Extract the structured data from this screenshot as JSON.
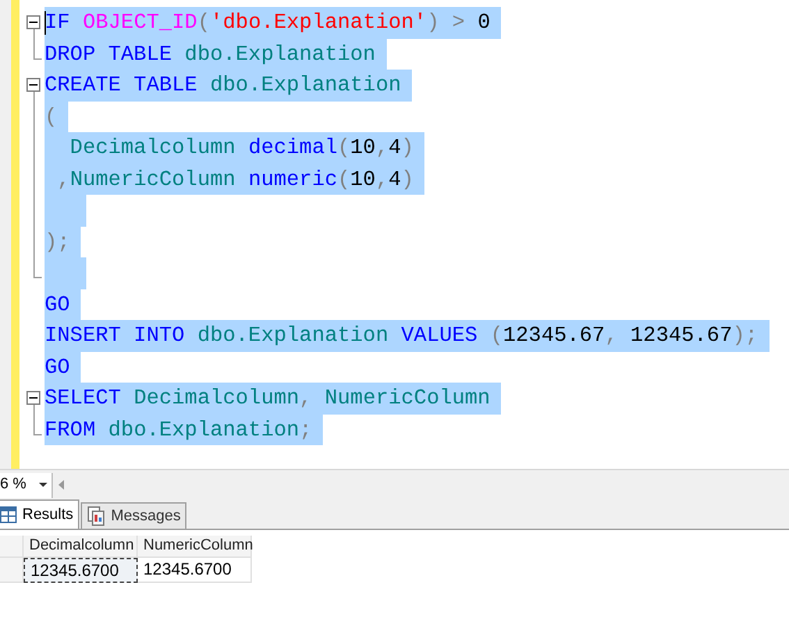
{
  "editor": {
    "lines": [
      {
        "kind": "fold-start",
        "selected": true,
        "caret": true,
        "tokens": [
          {
            "kind": "keyword",
            "text": "IF "
          },
          {
            "kind": "function",
            "text": "OBJECT_ID"
          },
          {
            "kind": "punct",
            "text": "("
          },
          {
            "kind": "string",
            "text": "'dbo.Explanation'"
          },
          {
            "kind": "punct",
            "text": ") > "
          },
          {
            "kind": "number",
            "text": "0"
          }
        ]
      },
      {
        "kind": "fold-end",
        "selected": true,
        "caret": false,
        "tokens": [
          {
            "kind": "keyword",
            "text": "DROP TABLE "
          },
          {
            "kind": "identifier",
            "text": "dbo.Explanation"
          }
        ]
      },
      {
        "kind": "fold-start",
        "selected": true,
        "caret": false,
        "tokens": [
          {
            "kind": "keyword",
            "text": "CREATE TABLE "
          },
          {
            "kind": "identifier",
            "text": "dbo.Explanation"
          }
        ]
      },
      {
        "kind": "fold-inner",
        "selected": true,
        "caret": false,
        "tokens": [
          {
            "kind": "punct",
            "text": "("
          }
        ]
      },
      {
        "kind": "fold-inner",
        "selected": true,
        "caret": false,
        "tokens": [
          {
            "kind": "identifier",
            "text": "  Decimalcolumn "
          },
          {
            "kind": "keyword",
            "text": "decimal"
          },
          {
            "kind": "punct",
            "text": "("
          },
          {
            "kind": "number",
            "text": "10"
          },
          {
            "kind": "punct",
            "text": ","
          },
          {
            "kind": "number",
            "text": "4"
          },
          {
            "kind": "punct",
            "text": ")"
          }
        ]
      },
      {
        "kind": "fold-inner",
        "selected": true,
        "caret": false,
        "tokens": [
          {
            "kind": "punct",
            "text": " ,"
          },
          {
            "kind": "identifier",
            "text": "NumericColumn "
          },
          {
            "kind": "keyword",
            "text": "numeric"
          },
          {
            "kind": "punct",
            "text": "("
          },
          {
            "kind": "number",
            "text": "10"
          },
          {
            "kind": "punct",
            "text": ","
          },
          {
            "kind": "number",
            "text": "4"
          },
          {
            "kind": "punct",
            "text": ")"
          }
        ]
      },
      {
        "kind": "fold-inner",
        "selected": true,
        "caret": false
      },
      {
        "kind": "fold-inner",
        "selected": true,
        "caret": false,
        "tokens": [
          {
            "kind": "punct",
            "text": ");"
          }
        ]
      },
      {
        "kind": "fold-end",
        "selected": true,
        "caret": false
      },
      {
        "kind": "plain",
        "selected": true,
        "caret": false,
        "tokens": [
          {
            "kind": "keyword",
            "text": "GO"
          }
        ]
      },
      {
        "kind": "plain",
        "selected": true,
        "caret": false,
        "tokens": [
          {
            "kind": "keyword",
            "text": "INSERT INTO "
          },
          {
            "kind": "identifier",
            "text": "dbo.Explanation "
          },
          {
            "kind": "keyword",
            "text": "VALUES "
          },
          {
            "kind": "punct",
            "text": "("
          },
          {
            "kind": "number",
            "text": "12345.67"
          },
          {
            "kind": "punct",
            "text": ", "
          },
          {
            "kind": "number",
            "text": "12345.67"
          },
          {
            "kind": "punct",
            "text": ");"
          }
        ]
      },
      {
        "kind": "plain",
        "selected": true,
        "caret": false,
        "tokens": [
          {
            "kind": "keyword",
            "text": "GO"
          }
        ]
      },
      {
        "kind": "fold-start",
        "selected": true,
        "caret": false,
        "tokens": [
          {
            "kind": "keyword",
            "text": "SELECT "
          },
          {
            "kind": "identifier",
            "text": "Decimalcolumn"
          },
          {
            "kind": "punct",
            "text": ", "
          },
          {
            "kind": "identifier",
            "text": "NumericColumn"
          }
        ]
      },
      {
        "kind": "fold-end",
        "selected": true,
        "caret": false,
        "tokens": [
          {
            "kind": "keyword",
            "text": "FROM "
          },
          {
            "kind": "identifier",
            "text": "dbo.Explanation"
          },
          {
            "kind": "punct",
            "text": ";"
          }
        ]
      }
    ]
  },
  "zoom": {
    "value": "6 %"
  },
  "result_tabs": [
    {
      "label": "Results",
      "selected": true
    },
    {
      "label": "Messages",
      "selected": false
    }
  ],
  "grid": {
    "columns": [
      "Decimalcolumn",
      "NumericColumn"
    ],
    "rows": [
      {
        "cells": [
          {
            "text": "12345.6700",
            "focused": true
          },
          {
            "text": "12345.6700",
            "focused": false
          }
        ]
      }
    ]
  }
}
